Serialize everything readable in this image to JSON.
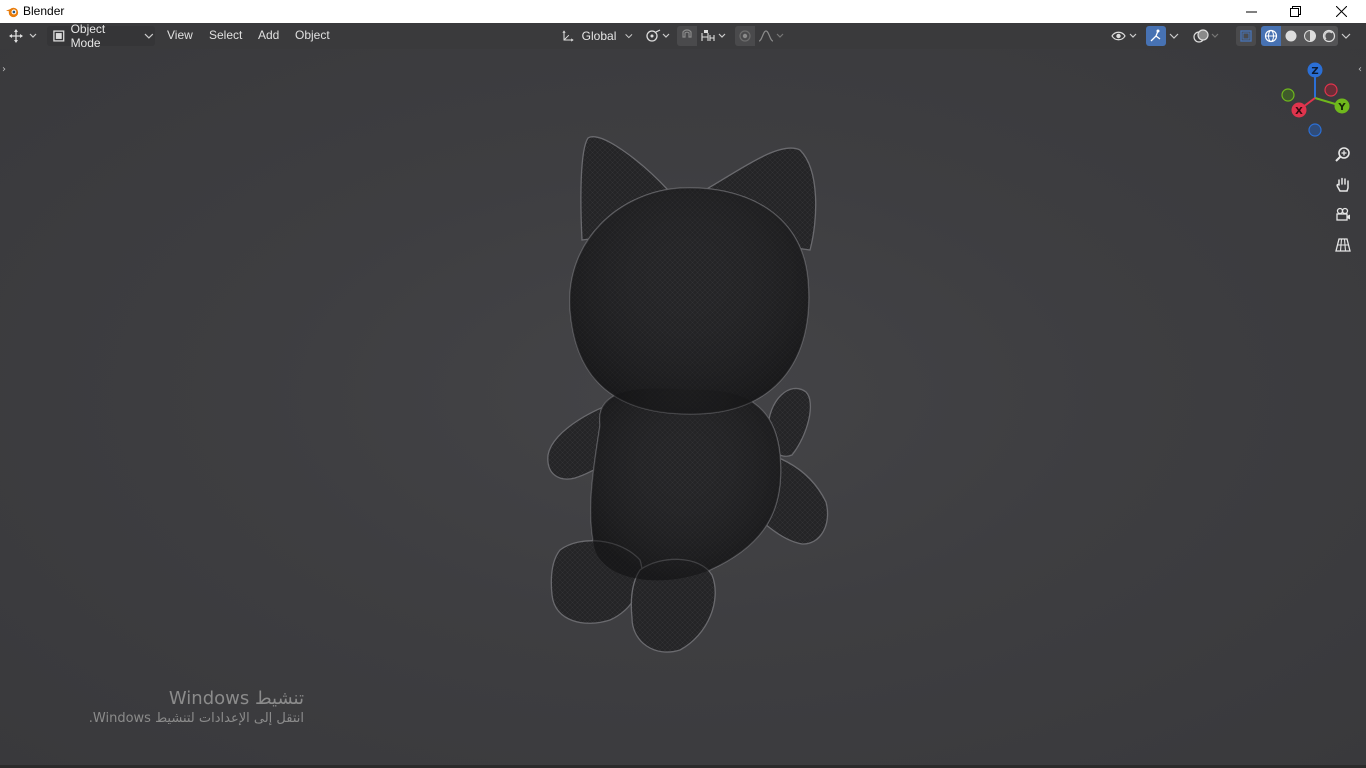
{
  "window": {
    "title": "Blender",
    "logo_icon": "blender-logo-icon",
    "controls": [
      "minimize-icon",
      "restore-icon",
      "close-icon"
    ]
  },
  "header": {
    "editor_type_icon": "object-move-editor-icon",
    "mode": {
      "label": "Object Mode",
      "icon": "object-mode-icon"
    },
    "menus": [
      "View",
      "Select",
      "Add",
      "Object"
    ],
    "transform_orientation": {
      "label": "Global",
      "icon": "orientation-axes-icon"
    },
    "pivot_icon": "pivot-point-icon",
    "snap_icon": "magnet-icon",
    "snap_target_icon": "snap-increment-icon",
    "proportional_icon": "proportional-edit-icon",
    "falloff_icon": "falloff-curve-icon",
    "right_icons": [
      "visibility-eye-icon",
      "gizmo-toggle-icon",
      "overlay-toggle-icon",
      "xray-toggle-icon",
      "wireframe-shading-icon",
      "solid-shading-icon",
      "material-shading-icon",
      "rendered-shading-icon"
    ]
  },
  "gizmo": {
    "axes": [
      {
        "label": "Z",
        "color": "#2b6fd6"
      },
      {
        "label": "Y",
        "color": "#6fb81c"
      },
      {
        "label": "X",
        "color": "#e0344d"
      }
    ]
  },
  "nav_icons": [
    "zoom-icon",
    "pan-hand-icon",
    "camera-view-icon",
    "ortho-grid-icon"
  ],
  "scene": {
    "object": "black-cat-plush-mesh"
  },
  "watermark": {
    "title": "تنشيط Windows",
    "subtitle": "انتقل إلى الإعدادات لتنشيط Windows."
  },
  "colors": {
    "viewport_bg": "#3d3d3d",
    "header_bg": "#3a3a3c",
    "accent_blue": "#4772b3"
  }
}
